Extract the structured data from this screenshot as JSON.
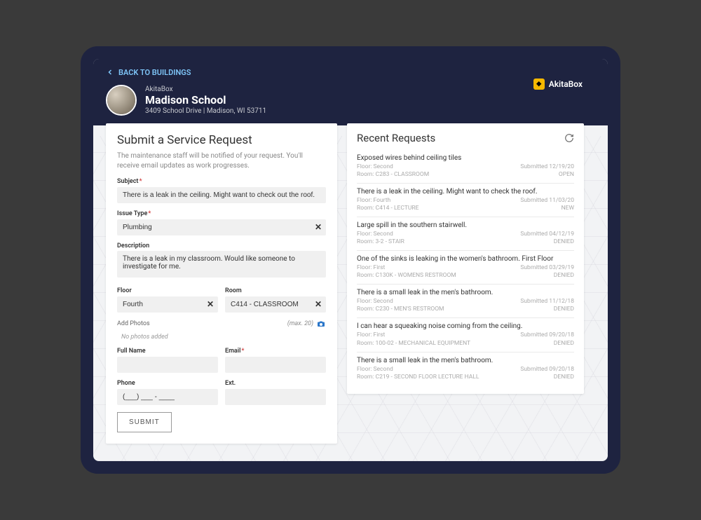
{
  "header": {
    "back_label": "BACK TO BUILDINGS",
    "brand_name": "AkitaBox",
    "org_name": "AkitaBox",
    "building_name": "Madison School",
    "building_address": "3409 School Drive | Madison, WI 53711"
  },
  "form": {
    "title": "Submit a Service Request",
    "description": "The maintenance staff will be notified of your request. You'll receive email updates as work progresses.",
    "subject_label": "Subject",
    "subject_value": "There is a leak in the ceiling. Might want to check out the roof.",
    "issue_type_label": "Issue Type",
    "issue_type_value": "Plumbing",
    "description_label": "Description",
    "description_value": "There is a leak in my classroom. Would like someone to investigate for me.",
    "floor_label": "Floor",
    "floor_value": "Fourth",
    "room_label": "Room",
    "room_value": "C414 - CLASSROOM",
    "photos_label": "Add Photos",
    "photos_max": "(max. 20)",
    "no_photos_text": "No photos added",
    "full_name_label": "Full Name",
    "email_label": "Email",
    "phone_label": "Phone",
    "phone_value": "(___) ___ - ____",
    "ext_label": "Ext.",
    "submit_label": "SUBMIT"
  },
  "recent": {
    "title": "Recent Requests",
    "items": [
      {
        "title": "Exposed wires behind ceiling tiles",
        "floor": "Floor: Second",
        "room": "Room: C283 - CLASSROOM",
        "submitted": "Submitted 12/19/20",
        "status": "OPEN"
      },
      {
        "title": "There is a leak in the ceiling. Might want to check the roof.",
        "floor": "Floor: Fourth",
        "room": "Room: C414 - LECTURE",
        "submitted": "Submitted 11/03/20",
        "status": "NEW"
      },
      {
        "title": "Large spill in the southern stairwell.",
        "floor": "Floor: Second",
        "room": "Room: 3-2 - STAIR",
        "submitted": "Submitted 04/12/19",
        "status": "DENIED"
      },
      {
        "title": "One of the sinks is leaking in the women's bathroom. First Floor",
        "floor": "Floor: First",
        "room": "Room: C130K - WOMENS RESTROOM",
        "submitted": "Submitted 03/29/19",
        "status": "DENIED"
      },
      {
        "title": "There is a small leak in the men's bathroom.",
        "floor": "Floor: Second",
        "room": "Room: C230 - MEN'S RESTROOM",
        "submitted": "Submitted 11/12/18",
        "status": "DENIED"
      },
      {
        "title": "I can hear a squeaking noise coming from the ceiling.",
        "floor": "Floor: First",
        "room": "Room: 100-02 - MECHANICAL EQUIPMENT",
        "submitted": "Submitted 09/20/18",
        "status": "DENIED"
      },
      {
        "title": "There is a small leak in the men's bathroom.",
        "floor": "Floor: Second",
        "room": "Room: C219 - SECOND FLOOR LECTURE HALL",
        "submitted": "Submitted 09/20/18",
        "status": "DENIED"
      }
    ]
  }
}
